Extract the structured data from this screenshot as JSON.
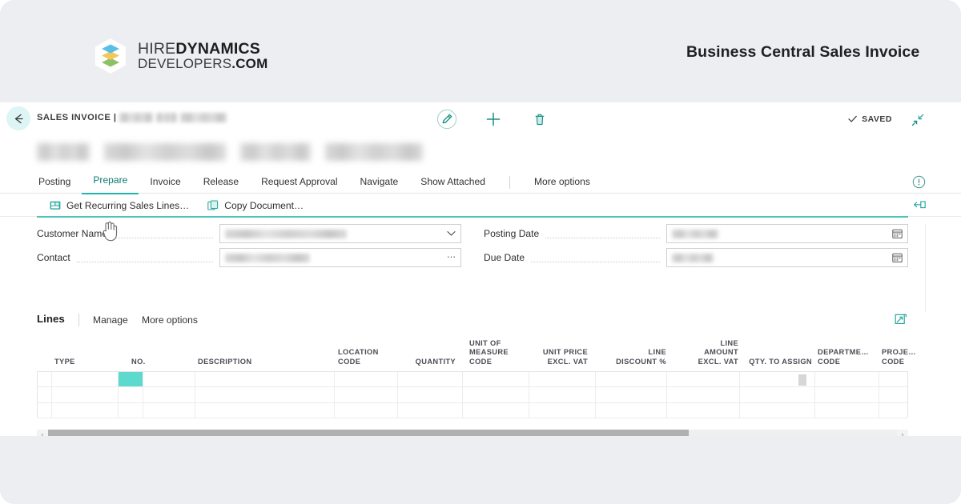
{
  "header": {
    "brand": {
      "logo_icon": "stacked-layers-icon",
      "line1_light": "HIRE",
      "line1_bold": "DYNAMICS",
      "line2_light": "DEVELOPERS",
      "line2_bold": ".COM"
    },
    "title": "Business Central Sales Invoice"
  },
  "app": {
    "topbar": {
      "back_icon": "back-arrow-icon",
      "breadcrumb_prefix": "SALES INVOICE |",
      "breadcrumb_value_redacted": true,
      "commands": [
        {
          "name": "edit-pencil-icon",
          "label": "Edit"
        },
        {
          "name": "plus-icon",
          "label": "New"
        },
        {
          "name": "trash-icon",
          "label": "Delete"
        }
      ],
      "saved_label": "SAVED",
      "saved_check_icon": "check-icon",
      "collapse_icon": "collapse-arrows-icon"
    },
    "document_title_redacted": true,
    "ribbon": {
      "tabs": [
        {
          "label": "Posting",
          "active": false
        },
        {
          "label": "Prepare",
          "active": true
        },
        {
          "label": "Invoice",
          "active": false
        },
        {
          "label": "Release",
          "active": false
        },
        {
          "label": "Request Approval",
          "active": false
        },
        {
          "label": "Navigate",
          "active": false
        },
        {
          "label": "Show Attached",
          "active": false
        }
      ],
      "more_options": "More options",
      "info_icon": "info-circle-icon"
    },
    "actions": [
      {
        "label": "Get Recurring Sales Lines…",
        "icon": "get-recurring-lines-icon"
      },
      {
        "label": "Copy Document…",
        "icon": "copy-document-icon"
      }
    ],
    "pin_icon": "pin-collapse-icon",
    "cursor_icon": "hand-pointer-cursor",
    "general": {
      "left_fields": [
        {
          "label": "Customer Name",
          "value_redacted": true,
          "control": "chevron-down-icon"
        },
        {
          "label": "Contact",
          "value_redacted": true,
          "control": "ellipsis-lookup-icon"
        }
      ],
      "right_fields": [
        {
          "label": "Posting Date",
          "value_redacted": true,
          "control": "calendar-icon"
        },
        {
          "label": "Due Date",
          "value_redacted": true,
          "control": "calendar-icon"
        }
      ]
    },
    "lines": {
      "title": "Lines",
      "actions": [
        {
          "label": "Manage"
        },
        {
          "label": "More options"
        }
      ],
      "open_in_excel_icon": "open-in-excel-icon",
      "columns": [
        {
          "key": "type",
          "header": "TYPE",
          "align": "left"
        },
        {
          "key": "no",
          "header": "NO.",
          "align": "left"
        },
        {
          "key": "description",
          "header": "DESCRIPTION",
          "align": "left"
        },
        {
          "key": "location_code",
          "header": "LOCATION\nCODE",
          "align": "left"
        },
        {
          "key": "quantity",
          "header": "QUANTITY",
          "align": "right"
        },
        {
          "key": "unit_of_measure_code",
          "header": "UNIT OF\nMEASURE\nCODE",
          "align": "left"
        },
        {
          "key": "unit_price_excl_vat",
          "header": "UNIT PRICE\nEXCL. VAT",
          "align": "right"
        },
        {
          "key": "line_discount_pct",
          "header": "LINE\nDISCOUNT %",
          "align": "right"
        },
        {
          "key": "line_amount_excl_vat",
          "header": "LINE\nAMOUNT\nEXCL. VAT",
          "align": "right"
        },
        {
          "key": "qty_to_assign",
          "header": "QTY. TO ASSIGN",
          "align": "right"
        },
        {
          "key": "department_code",
          "header": "DEPARTME…\nCODE",
          "align": "left"
        },
        {
          "key": "project_code",
          "header": "PROJE…\nCODE",
          "align": "left"
        }
      ],
      "rows": [
        {
          "selected_cell": "no",
          "cells": []
        },
        {
          "selected_cell": null,
          "cells": []
        },
        {
          "selected_cell": null,
          "cells": []
        }
      ],
      "scrollbar": {
        "left_arrow": "‹",
        "right_arrow": "›",
        "thumb_fraction": 0.755
      }
    }
  },
  "colors": {
    "page_background": "#eceef1",
    "accent_teal": "#23b3a8",
    "selection_teal": "#5ed9cd",
    "text_primary": "#1f2023",
    "grid_line": "#ececec"
  }
}
